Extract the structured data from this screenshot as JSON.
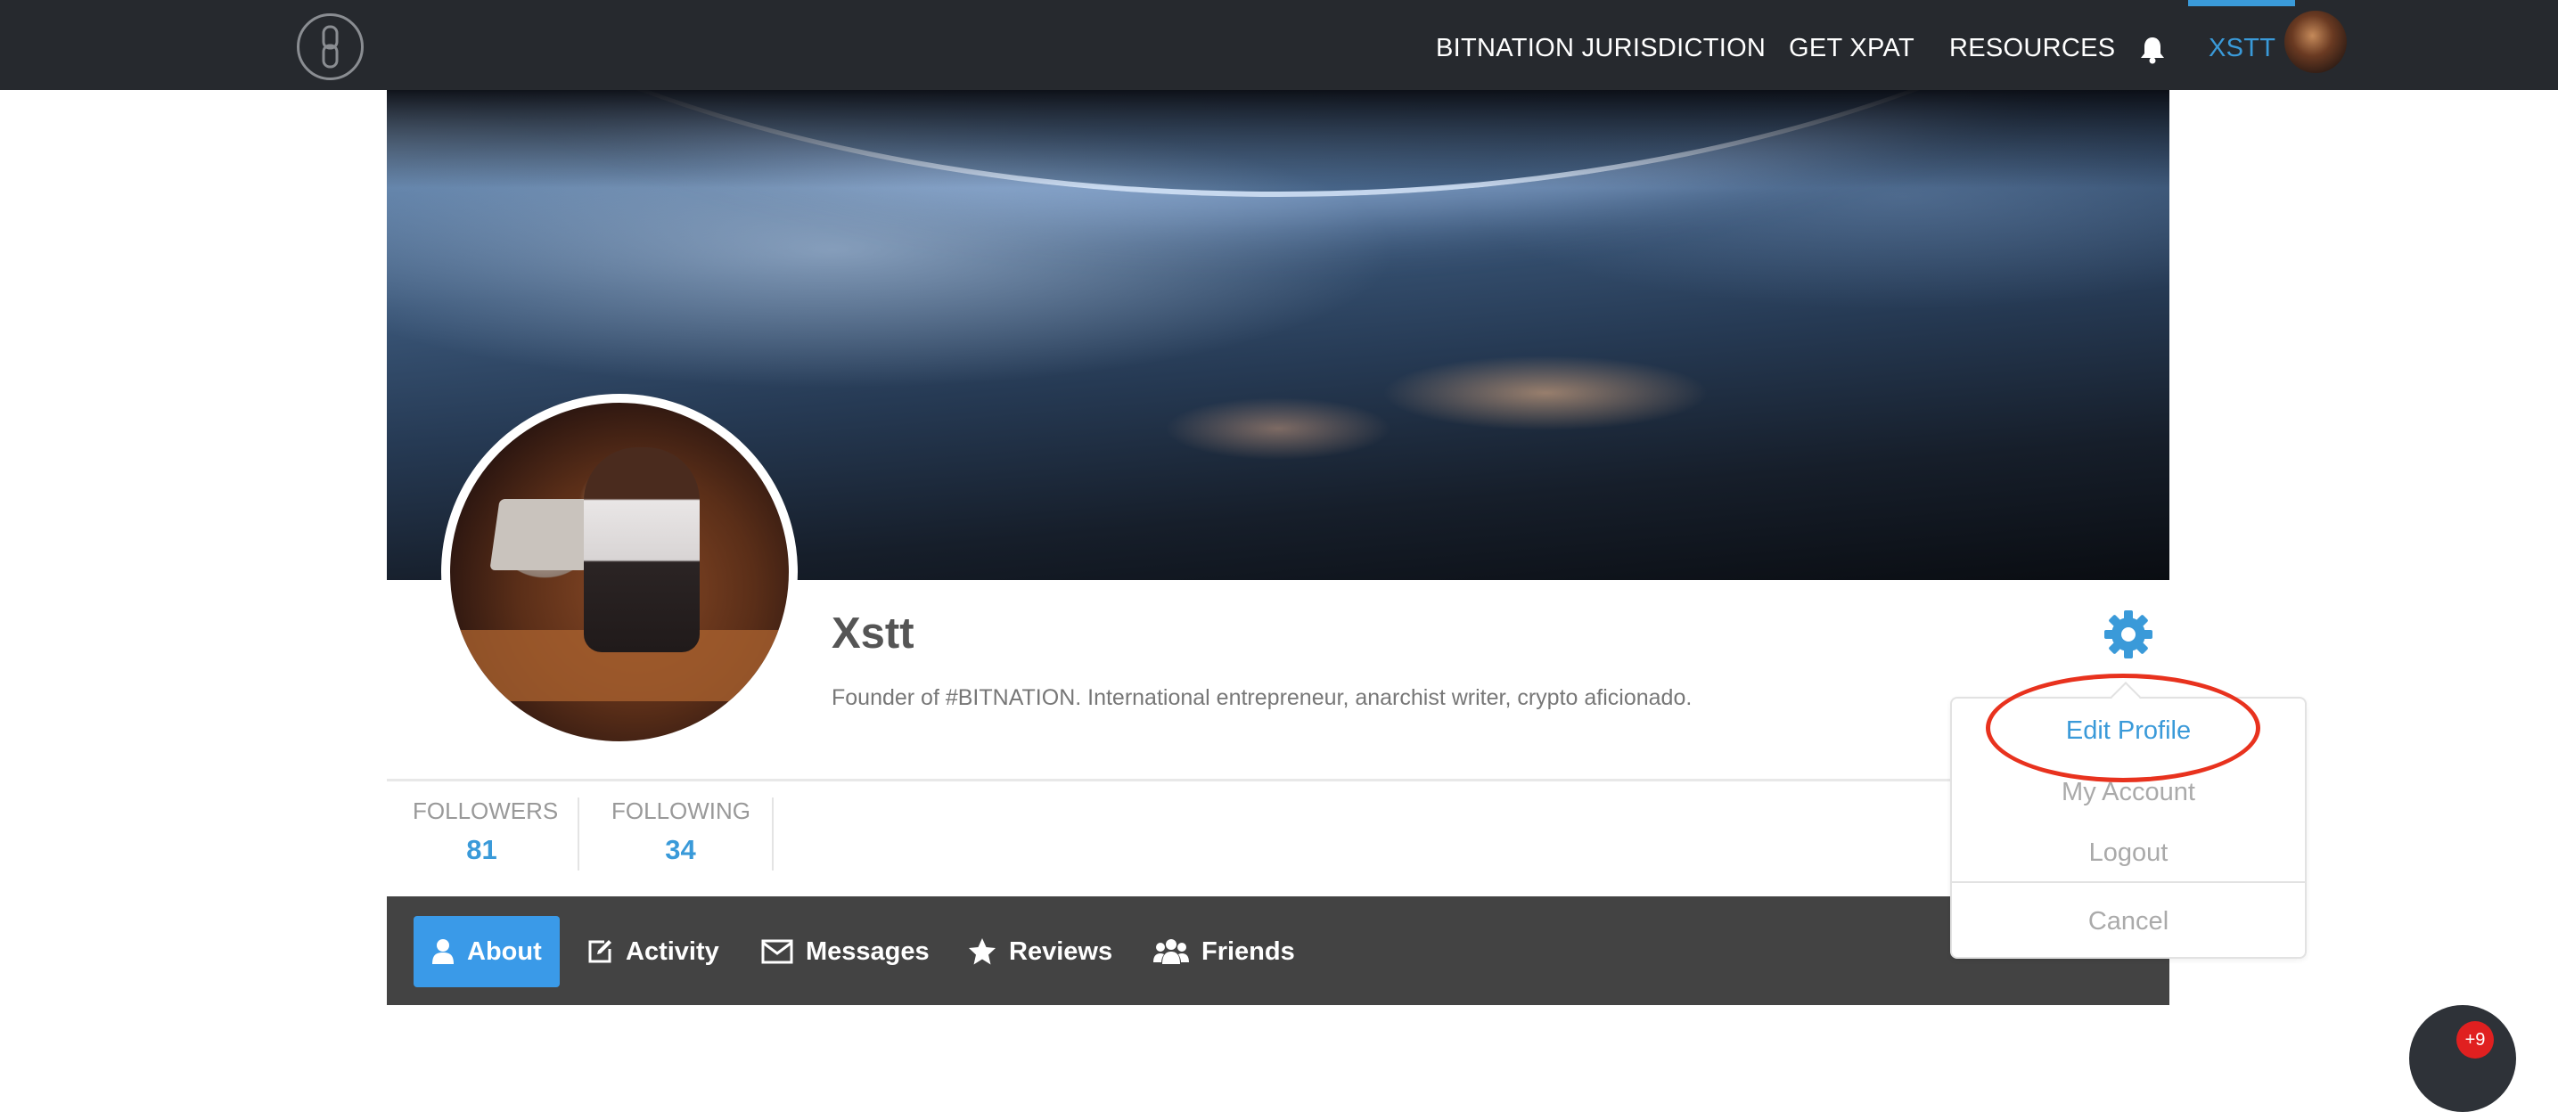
{
  "nav": {
    "items": [
      "BITNATION JURISDICTION",
      "GET XPAT",
      "RESOURCES"
    ],
    "user_label": "XSTT",
    "accent_color": "#3a9ad9"
  },
  "profile": {
    "name": "Xstt",
    "bio": "Founder of #BITNATION. International entrepreneur, anarchist writer, crypto aficionado."
  },
  "stats": [
    {
      "label": "FOLLOWERS",
      "value": "81"
    },
    {
      "label": "FOLLOWING",
      "value": "34"
    }
  ],
  "tabs": [
    {
      "label": "About",
      "icon": "user-icon",
      "active": true
    },
    {
      "label": "Activity",
      "icon": "edit-icon",
      "active": false
    },
    {
      "label": "Messages",
      "icon": "envelope-icon",
      "active": false
    },
    {
      "label": "Reviews",
      "icon": "star-icon",
      "active": false
    },
    {
      "label": "Friends",
      "icon": "users-icon",
      "active": false
    }
  ],
  "settings_menu": {
    "items": [
      "Edit Profile",
      "My Account",
      "Logout"
    ],
    "cancel": "Cancel"
  },
  "chat": {
    "badge": "+9"
  }
}
